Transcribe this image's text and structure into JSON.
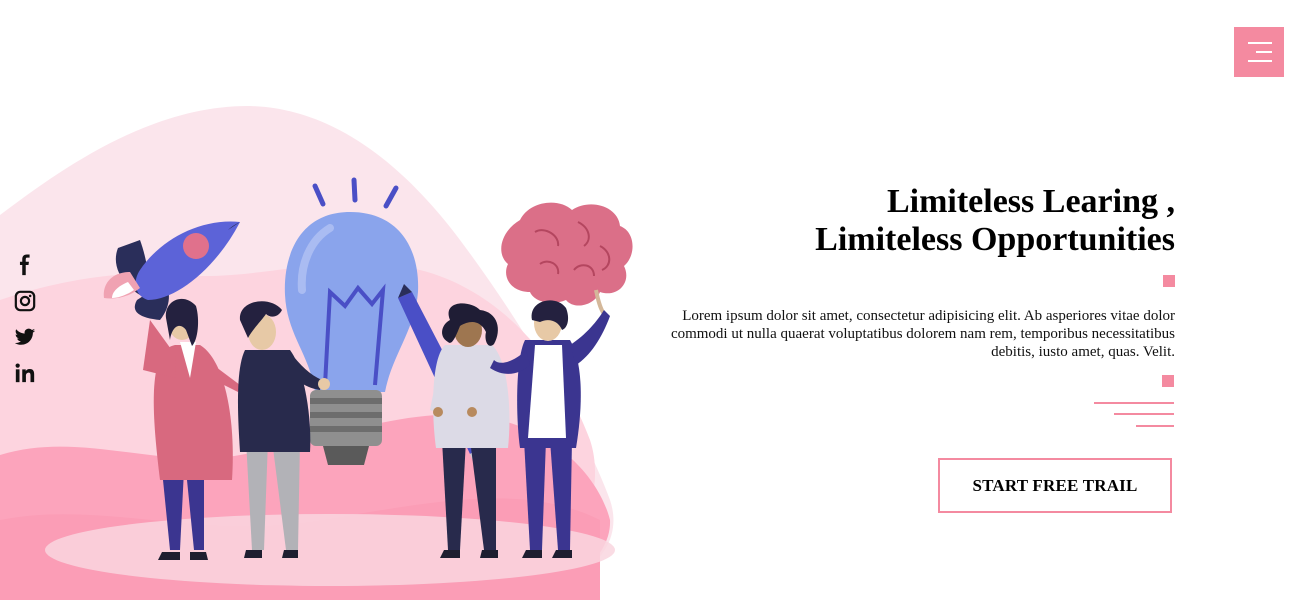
{
  "nav": {
    "menu_icon": "hamburger-icon",
    "menu_color": "#f48aa0"
  },
  "social": {
    "items": [
      {
        "name": "facebook",
        "icon": "facebook-icon"
      },
      {
        "name": "instagram",
        "icon": "instagram-icon"
      },
      {
        "name": "twitter",
        "icon": "twitter-icon"
      },
      {
        "name": "linkedin",
        "icon": "linkedin-icon"
      }
    ]
  },
  "hero": {
    "title_line1": "Limiteless Learing ,",
    "title_line2": "Limiteless Opportunities",
    "description": "Lorem ipsum dolor sit amet, consectetur adipisicing elit. Ab asperiores vitae dolor commodi ut nulla quaerat voluptatibus dolorem nam rem, temporibus necessitatibus debitis, iusto amet, quas. Velit.",
    "cta_label": "START FREE TRAIL",
    "illustration": "people-with-lightbulb-rocket-brain-pencil",
    "accent_color": "#f48aa0"
  }
}
